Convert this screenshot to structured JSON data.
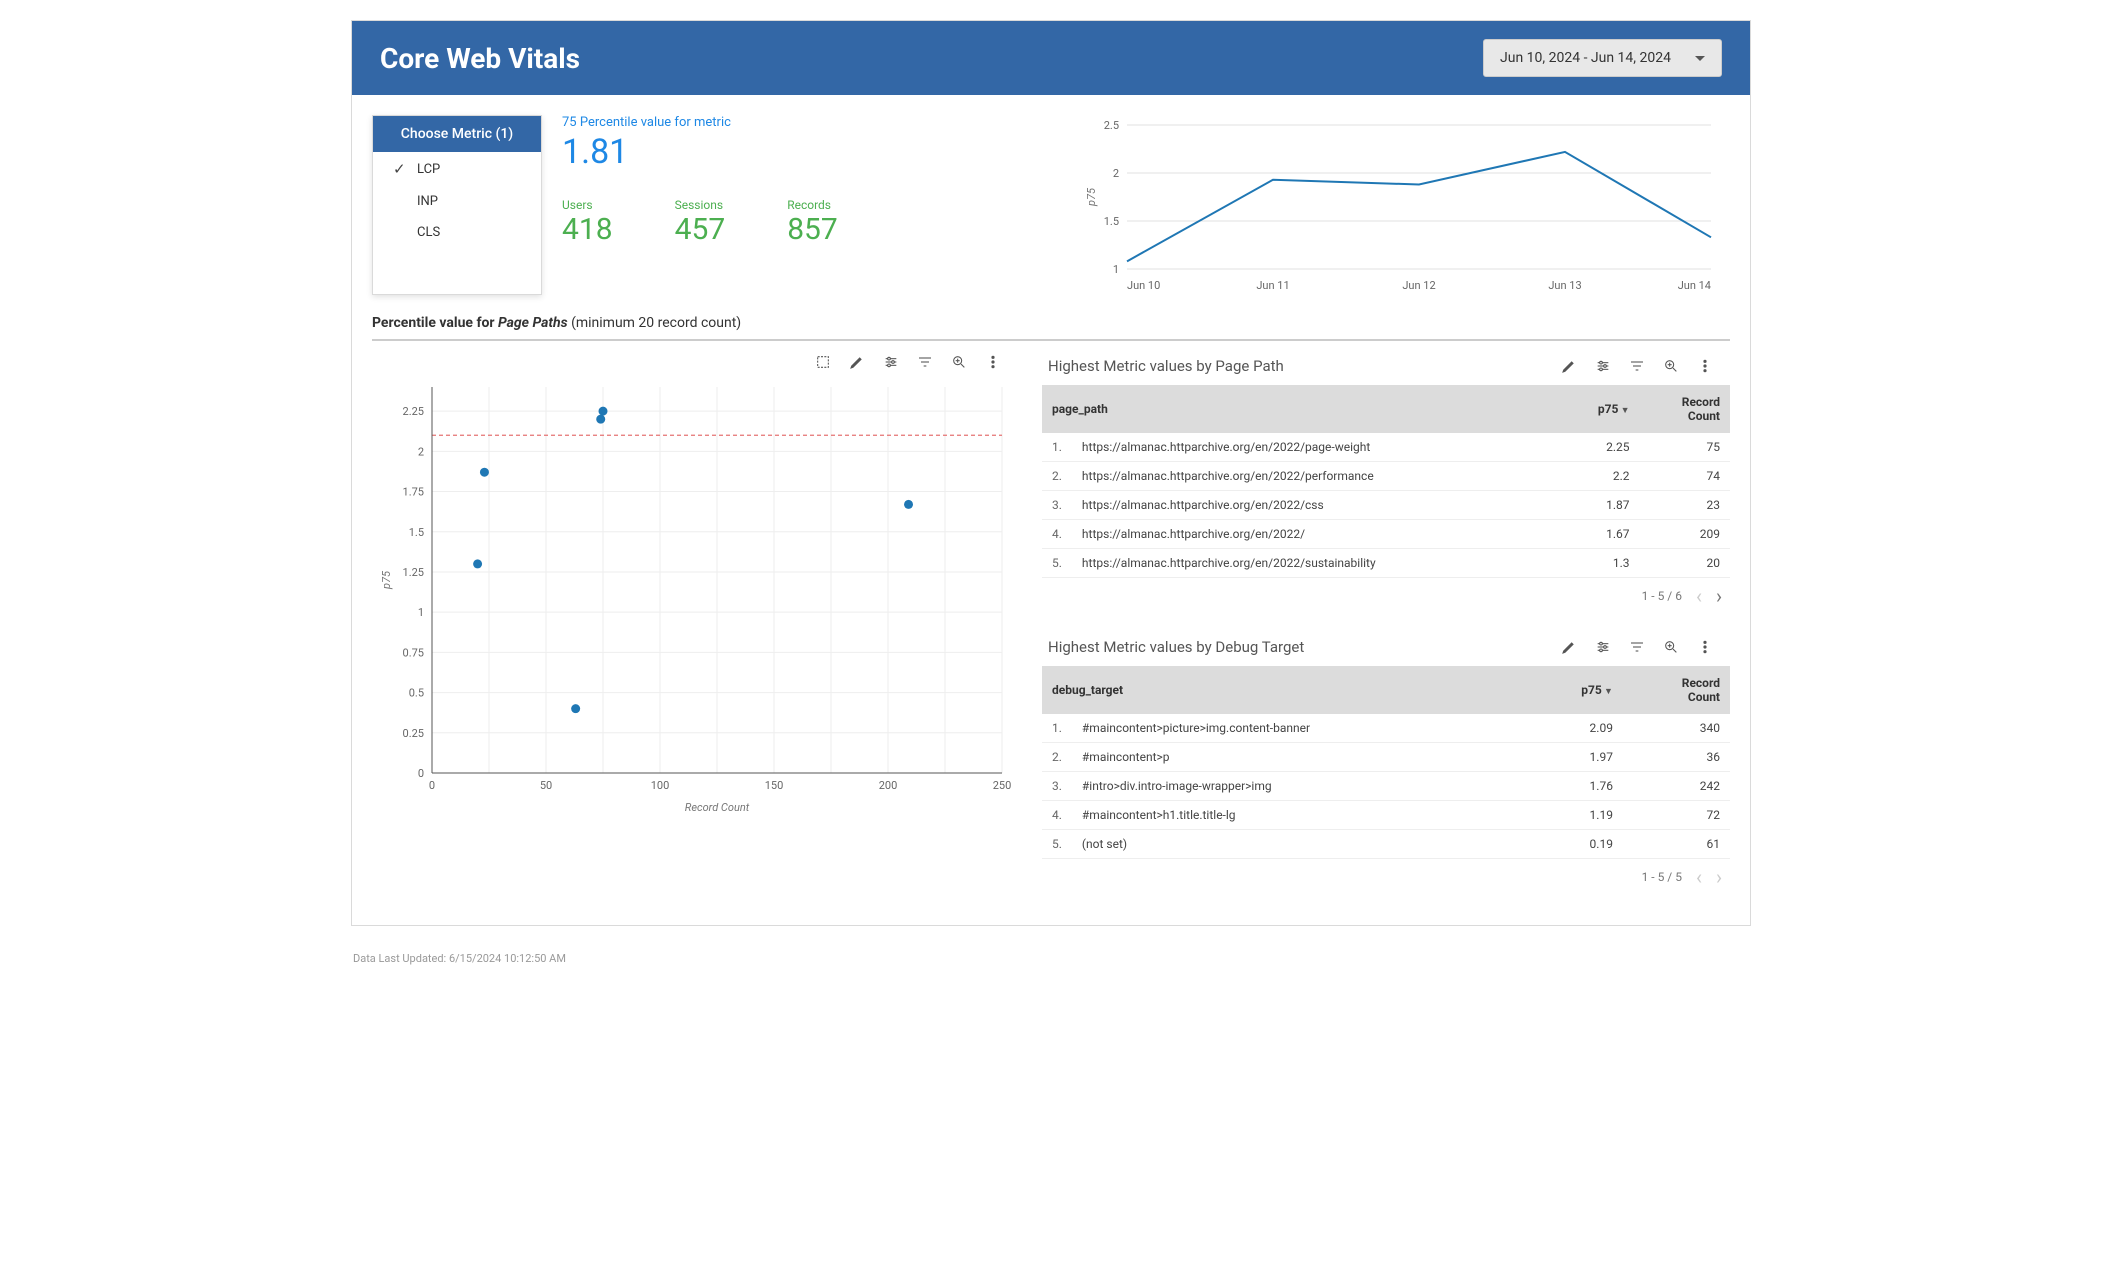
{
  "header": {
    "title": "Core Web Vitals",
    "date_range": "Jun 10, 2024 - Jun 14, 2024"
  },
  "metric_picker": {
    "header": "Choose Metric (1)",
    "options": [
      {
        "label": "LCP",
        "selected": true
      },
      {
        "label": "INP",
        "selected": false
      },
      {
        "label": "CLS",
        "selected": false
      }
    ]
  },
  "summary": {
    "p75_label": "75 Percentile value for metric",
    "p75_value": "1.81",
    "stats": [
      {
        "label": "Users",
        "value": "418"
      },
      {
        "label": "Sessions",
        "value": "457"
      },
      {
        "label": "Records",
        "value": "857"
      }
    ]
  },
  "section_title": {
    "prefix": "Percentile value for ",
    "italic": "Page Paths",
    "suffix": " (minimum 20 record count)"
  },
  "toolbar_icons": [
    "select-icon",
    "edit-icon",
    "adjust-icon",
    "filter-icon",
    "zoom-icon",
    "more-icon"
  ],
  "chart_data": [
    {
      "id": "timeseries",
      "type": "line",
      "title": "",
      "xlabel": "",
      "ylabel": "p75",
      "categories": [
        "Jun 10",
        "Jun 11",
        "Jun 12",
        "Jun 13",
        "Jun 14"
      ],
      "values": [
        1.08,
        1.93,
        1.88,
        2.22,
        1.33
      ],
      "ylim": [
        1,
        2.5
      ],
      "yticks": [
        1,
        1.5,
        2,
        2.5
      ]
    },
    {
      "id": "scatter",
      "type": "scatter",
      "title": "",
      "xlabel": "Record Count",
      "ylabel": "p75",
      "xlim": [
        0,
        250
      ],
      "ylim": [
        0,
        2.4
      ],
      "xticks": [
        0,
        50,
        100,
        150,
        200,
        250
      ],
      "yticks": [
        0,
        0.25,
        0.5,
        0.75,
        1,
        1.25,
        1.5,
        1.75,
        2,
        2.25
      ],
      "reference_line_y": 2.1,
      "points": [
        {
          "x": 75,
          "y": 2.25
        },
        {
          "x": 74,
          "y": 2.2
        },
        {
          "x": 23,
          "y": 1.87
        },
        {
          "x": 209,
          "y": 1.67
        },
        {
          "x": 20,
          "y": 1.3
        },
        {
          "x": 63,
          "y": 0.4
        }
      ]
    }
  ],
  "tables": {
    "page_path": {
      "title": "Highest Metric values by Page Path",
      "columns": [
        "page_path",
        "p75",
        "Record Count"
      ],
      "sort_col": 1,
      "rows": [
        [
          "https://almanac.httparchive.org/en/2022/page-weight",
          "2.25",
          "75"
        ],
        [
          "https://almanac.httparchive.org/en/2022/performance",
          "2.2",
          "74"
        ],
        [
          "https://almanac.httparchive.org/en/2022/css",
          "1.87",
          "23"
        ],
        [
          "https://almanac.httparchive.org/en/2022/",
          "1.67",
          "209"
        ],
        [
          "https://almanac.httparchive.org/en/2022/sustainability",
          "1.3",
          "20"
        ]
      ],
      "pager": "1 - 5 / 6",
      "has_next": true
    },
    "debug_target": {
      "title": "Highest Metric values by Debug Target",
      "columns": [
        "debug_target",
        "p75",
        "Record Count"
      ],
      "sort_col": 1,
      "rows": [
        [
          "#maincontent>picture>img.content-banner",
          "2.09",
          "340"
        ],
        [
          "#maincontent>p",
          "1.97",
          "36"
        ],
        [
          "#intro>div.intro-image-wrapper>img",
          "1.76",
          "242"
        ],
        [
          "#maincontent>h1.title.title-lg",
          "1.19",
          "72"
        ],
        [
          "(not set)",
          "0.19",
          "61"
        ]
      ],
      "pager": "1 - 5 / 5",
      "has_next": false
    }
  },
  "footer": "Data Last Updated: 6/15/2024 10:12:50 AM"
}
